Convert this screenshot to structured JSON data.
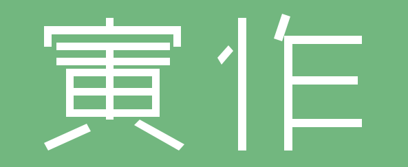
{
  "logo": {
    "text": "寅作",
    "background_color": "#72b77f",
    "foreground_color": "#ffffff"
  }
}
